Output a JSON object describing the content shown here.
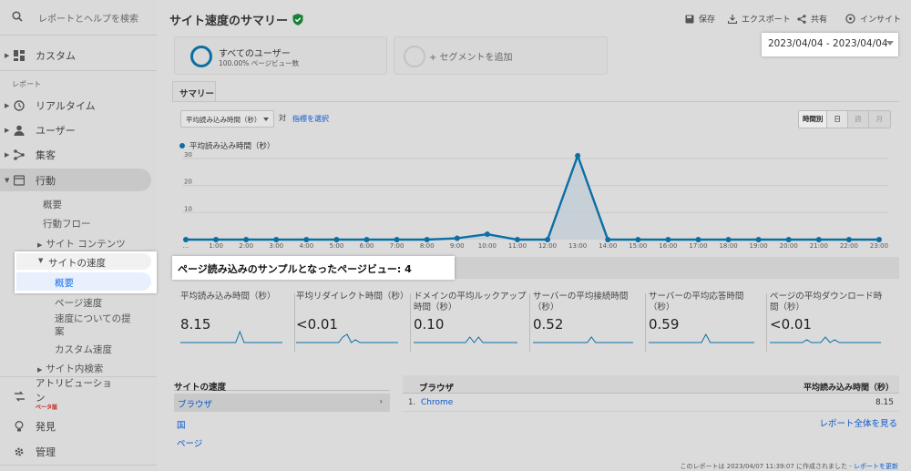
{
  "search": {
    "placeholder": "レポートとヘルプを検索"
  },
  "nav": {
    "custom": "カスタム",
    "reports_header": "レポート",
    "realtime": "リアルタイム",
    "users": "ユーザー",
    "acquisition": "集客",
    "behavior": "行動",
    "overview": "概要",
    "behavior_flow": "行動フロー",
    "site_content": "サイト コンテンツ",
    "site_speed": "サイトの速度",
    "speed_overview": "概要",
    "page_timings": "ページ速度",
    "speed_suggestions_1": "速度についての提",
    "speed_suggestions_2": "案",
    "user_timings": "カスタム速度",
    "site_search": "サイト内検索",
    "attribution_1": "アトリビューショ",
    "attribution_2": "ン",
    "beta": "ベータ版",
    "discover": "発見",
    "admin": "管理"
  },
  "header": {
    "title": "サイト速度のサマリー",
    "save": "保存",
    "export": "エクスポート",
    "share": "共有",
    "insights": "インサイト"
  },
  "segments": {
    "all_users": "すべてのユーザー",
    "all_users_sub": "100.00% ページビュー数",
    "add_segment": "+ セグメントを追加"
  },
  "date_range": "2023/04/04 - 2023/04/04",
  "tabs": {
    "summary": "サマリー"
  },
  "controls": {
    "metric_select": "平均読み込み時間（秒）",
    "vs": "対",
    "select_metric": "指標を選択",
    "hourly": "時間別",
    "day": "日",
    "week": "週",
    "month": "月"
  },
  "colors": {
    "series": "#0b6fa4",
    "accent": "#1a73e8"
  },
  "chart_data": {
    "type": "line",
    "legend": "平均読み込み時間（秒）",
    "x": [
      "...",
      "1:00",
      "2:00",
      "3:00",
      "4:00",
      "5:00",
      "6:00",
      "7:00",
      "8:00",
      "9:00",
      "10:00",
      "11:00",
      "12:00",
      "13:00",
      "14:00",
      "15:00",
      "16:00",
      "17:00",
      "18:00",
      "19:00",
      "20:00",
      "21:00",
      "22:00",
      "23:00"
    ],
    "series": [
      {
        "name": "平均読み込み時間（秒）",
        "values": [
          0,
          0,
          0,
          0,
          0,
          0,
          0,
          0,
          0,
          0.5,
          2,
          0,
          0,
          31,
          0,
          0,
          0,
          0,
          0,
          0,
          0,
          0,
          0,
          0
        ]
      }
    ],
    "yticks": [
      "30",
      "20",
      "10"
    ],
    "ylim": [
      0,
      33
    ]
  },
  "banner": "ページ読み込みのサンプルとなったページビュー: 4",
  "metrics": [
    {
      "title": "平均読み込み時間（秒）",
      "value": "8.15"
    },
    {
      "title": "平均リダイレクト時間（秒）",
      "value": "<0.01"
    },
    {
      "title": "ドメインの平均ルックアップ時間（秒）",
      "value": "0.10"
    },
    {
      "title": "サーバーの平均接続時間（秒）",
      "value": "0.52"
    },
    {
      "title": "サーバーの平均応答時間（秒）",
      "value": "0.59"
    },
    {
      "title": "ページの平均ダウンロード時間（秒）",
      "value": "<0.01"
    }
  ],
  "table": {
    "left_header": "サイトの速度",
    "left_items": [
      "ブラウザ",
      "国",
      "ページ"
    ],
    "col_browser": "ブラウザ",
    "col_avg": "平均読み込み時間（秒）",
    "rows": [
      {
        "idx": "1.",
        "name": "Chrome",
        "value": "8.15"
      }
    ],
    "full_report": "レポート全体を見る"
  },
  "footer": {
    "text": "このレポートは 2023/04/07 11:39:07 に作成されました -",
    "refresh": "レポートを更新"
  }
}
